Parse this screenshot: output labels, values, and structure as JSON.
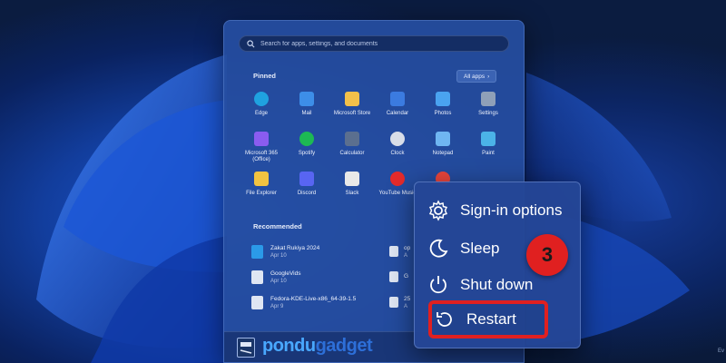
{
  "search": {
    "placeholder": "Search for apps, settings, and documents"
  },
  "pinned": {
    "title": "Pinned",
    "all_apps_label": "All apps",
    "apps": [
      {
        "label": "Edge",
        "icon": "edge-icon",
        "color": "#1fa2e0"
      },
      {
        "label": "Mail",
        "icon": "mail-icon",
        "color": "#3d8ee8"
      },
      {
        "label": "Microsoft Store",
        "icon": "store-icon",
        "color": "#f3c04a"
      },
      {
        "label": "Calendar",
        "icon": "calendar-icon",
        "color": "#3b7be0"
      },
      {
        "label": "Photos",
        "icon": "photos-icon",
        "color": "#4aa3f0"
      },
      {
        "label": "Settings",
        "icon": "gear-icon",
        "color": "#8fa0b8"
      },
      {
        "label": "Microsoft 365 (Office)",
        "icon": "office-icon",
        "color": "#8a5cf0"
      },
      {
        "label": "Spotify",
        "icon": "spotify-icon",
        "color": "#1db954"
      },
      {
        "label": "Calculator",
        "icon": "calculator-icon",
        "color": "#5b6f8f"
      },
      {
        "label": "Clock",
        "icon": "clock-icon",
        "color": "#d8dde8"
      },
      {
        "label": "Notepad",
        "icon": "notepad-icon",
        "color": "#6fb6f2"
      },
      {
        "label": "Paint",
        "icon": "paint-icon",
        "color": "#4bb3e8"
      },
      {
        "label": "File Explorer",
        "icon": "folder-icon",
        "color": "#f2c341"
      },
      {
        "label": "Discord",
        "icon": "discord-icon",
        "color": "#5865f2"
      },
      {
        "label": "Slack",
        "icon": "slack-icon",
        "color": "#e8e8e8"
      },
      {
        "label": "YouTube Music",
        "icon": "youtube-music-icon",
        "color": "#e52b2b"
      },
      {
        "label": "",
        "icon": "chrome-icon",
        "color": "#e8453c"
      }
    ]
  },
  "recommended": {
    "title": "Recommended",
    "items": [
      {
        "name": "Zakat Rukiya 2024",
        "date": "Apr 10",
        "icon": "edge-file-icon",
        "color": "#2b9ae8"
      },
      {
        "name": "GoogleVids",
        "date": "Apr 10",
        "icon": "image-file-icon",
        "color": "#dfe6f3"
      },
      {
        "name": "Fedora-KDE-Live-x86_64-39-1.5",
        "date": "Apr 9",
        "icon": "disc-file-icon",
        "color": "#dfe6f3"
      }
    ],
    "right_items": [
      {
        "name": "op",
        "date": "A"
      },
      {
        "name": "G",
        "date": ""
      },
      {
        "name": "25",
        "date": "A"
      }
    ]
  },
  "power_menu": {
    "items": [
      {
        "label": "Sign-in options",
        "icon": "gear-icon"
      },
      {
        "label": "Sleep",
        "icon": "moon-icon"
      },
      {
        "label": "Shut down",
        "icon": "power-icon"
      },
      {
        "label": "Restart",
        "icon": "restart-icon"
      }
    ]
  },
  "step_badge": "3",
  "watermark": {
    "part1": "pondu",
    "part2": "gadget"
  },
  "corner_text": "Ev",
  "colors": {
    "highlight": "#e02020",
    "accent": "#49a8ff"
  }
}
